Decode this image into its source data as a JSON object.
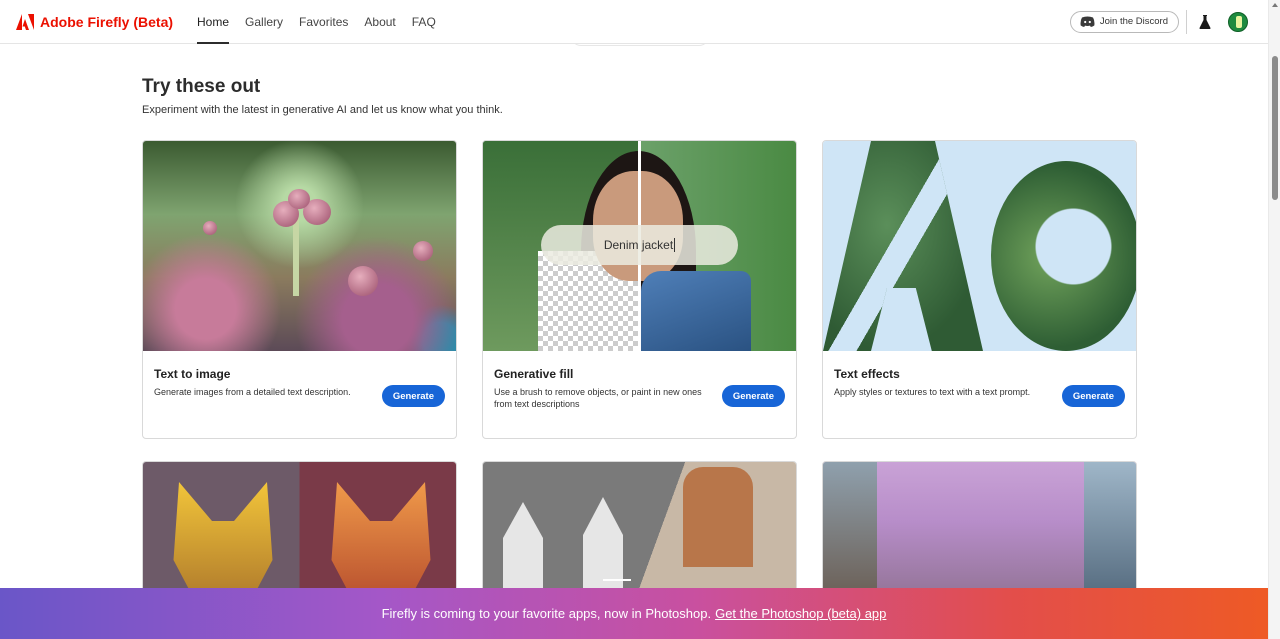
{
  "header": {
    "brand": "Adobe Firefly (Beta)",
    "nav": [
      "Home",
      "Gallery",
      "Favorites",
      "About",
      "FAQ"
    ],
    "active_nav": "Home",
    "discord_label": "Join the Discord"
  },
  "section": {
    "title": "Try these out",
    "subtitle": "Experiment with the latest in generative AI and let us know what you think."
  },
  "cards": [
    {
      "title": "Text to image",
      "desc": "Generate images from a detailed text description.",
      "button": "Generate"
    },
    {
      "title": "Generative fill",
      "desc": "Use a brush to remove objects, or paint in new ones from text descriptions",
      "button": "Generate",
      "prompt": "Denim jacket"
    },
    {
      "title": "Text effects",
      "desc": "Apply styles or textures to text with a text prompt.",
      "button": "Generate"
    }
  ],
  "banner": {
    "text": "Firefly is coming to your favorite apps, now in Photoshop.",
    "link": "Get the Photoshop (beta) app"
  },
  "colors": {
    "brand_red": "#eb1000",
    "button_blue": "#1765d7"
  }
}
